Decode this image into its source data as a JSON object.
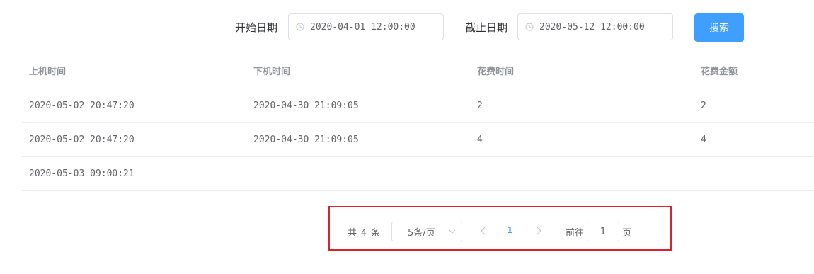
{
  "filters": {
    "start_label": "开始日期",
    "start_value": "2020-04-01 12:00:00",
    "end_label": "截止日期",
    "end_value": "2020-05-12 12:00:00",
    "search_label": "搜索",
    "icon": "clock-icon"
  },
  "table": {
    "headers": [
      "上机时间",
      "下机时间",
      "花费时间",
      "花费金额"
    ],
    "rows": [
      [
        "2020-05-02 20:47:20",
        "2020-04-30 21:09:05",
        "2",
        "2"
      ],
      [
        "2020-05-02 20:47:20",
        "2020-04-30 21:09:05",
        "4",
        "4"
      ],
      [
        "2020-05-03 09:00:21",
        "",
        "",
        ""
      ]
    ]
  },
  "pagination": {
    "total_prefix": "共",
    "total": "4",
    "total_suffix": "条",
    "page_size": "5条/页",
    "current_page": "1",
    "goto_prefix": "前往",
    "goto_value": "1",
    "goto_suffix": "页"
  },
  "colors": {
    "primary": "#409eff",
    "highlight_border": "#d9232d"
  }
}
